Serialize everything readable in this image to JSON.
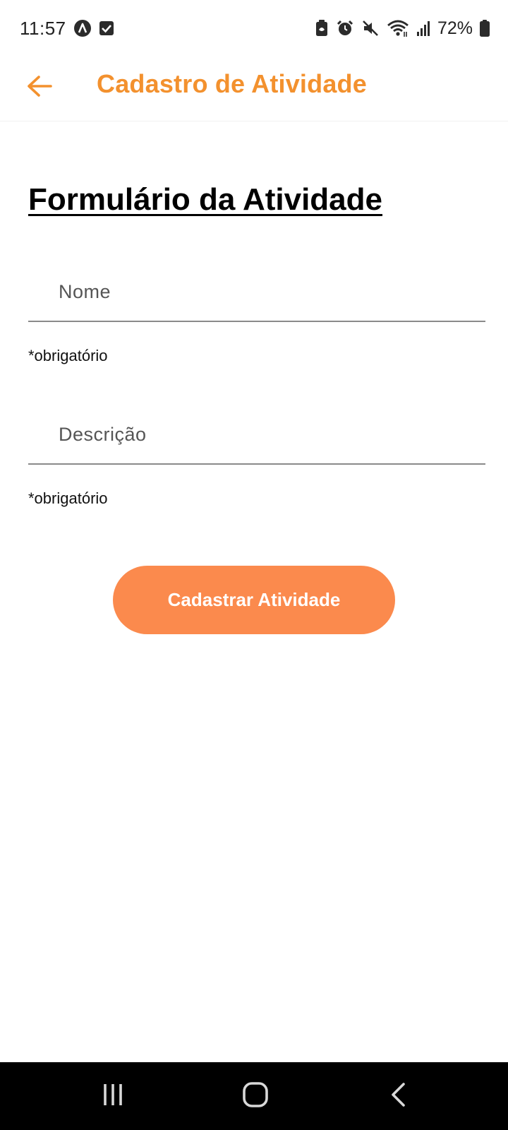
{
  "status_bar": {
    "time": "11:57",
    "battery": "72%",
    "icons": [
      "app-notification-icon",
      "checkbox-notification-icon",
      "battery-saver-icon",
      "alarm-icon",
      "mute-icon",
      "wifi-icon",
      "signal-icon",
      "battery-icon"
    ]
  },
  "app_bar": {
    "title": "Cadastro de Atividade",
    "back_icon": "arrow-back-icon"
  },
  "form": {
    "heading": "Formulário da Atividade",
    "fields": [
      {
        "placeholder": "Nome",
        "value": "",
        "hint": "*obrigatório"
      },
      {
        "placeholder": "Descrição",
        "value": "",
        "hint": "*obrigatório"
      }
    ],
    "submit_label": "Cadastrar Atividade"
  },
  "nav_bar": {
    "buttons": [
      "recents-icon",
      "home-icon",
      "back-icon"
    ]
  },
  "colors": {
    "accent": "#f3912e",
    "button": "#fb8a4d",
    "nav_background": "#000000"
  }
}
